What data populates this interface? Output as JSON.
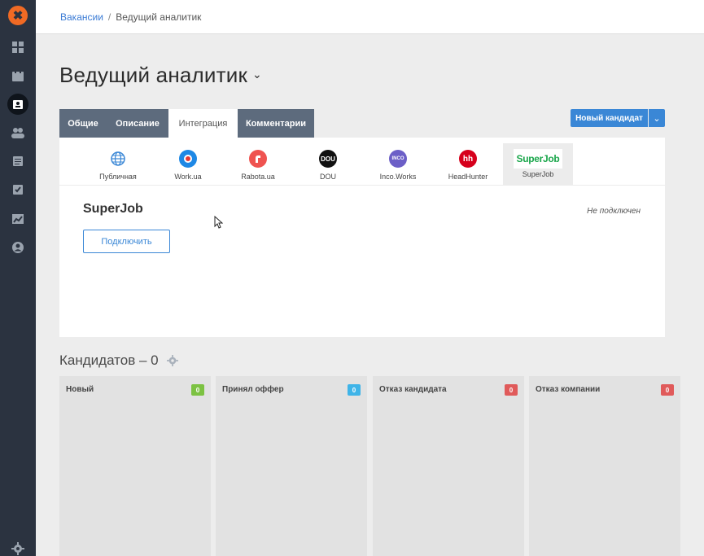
{
  "logo": "✖",
  "sidebar": {
    "items": [
      {
        "icon": "dashboard-icon",
        "active": false
      },
      {
        "icon": "calendar-icon",
        "active": false
      },
      {
        "icon": "vacancies-icon",
        "active": true
      },
      {
        "icon": "users-icon",
        "active": false
      },
      {
        "icon": "library-icon",
        "active": false
      },
      {
        "icon": "tasks-icon",
        "active": false
      },
      {
        "icon": "analytics-icon",
        "active": false
      },
      {
        "icon": "profile-icon",
        "active": false
      }
    ],
    "settings_icon": "gear-icon"
  },
  "breadcrumb": {
    "link": "Вакансии",
    "separator": "/",
    "current": "Ведущий аналитик"
  },
  "page_title": "Ведущий аналитик",
  "tabs": [
    {
      "label": "Общие"
    },
    {
      "label": "Описание"
    },
    {
      "label": "Интеграция"
    },
    {
      "label": "Комментарии"
    }
  ],
  "new_candidate_button": "Новый кандидат",
  "integrations": [
    {
      "label": "Публичная",
      "icon": "globe-icon",
      "color": "#3a87d6"
    },
    {
      "label": "Work.ua",
      "icon": "workua-icon",
      "color": "#1e88e5"
    },
    {
      "label": "Rabota.ua",
      "icon": "rabotaua-icon",
      "color": "#ef5350"
    },
    {
      "label": "DOU",
      "icon": "dou-icon",
      "color": "#111111",
      "glyph": "DOU"
    },
    {
      "label": "Inco.Works",
      "icon": "incoworks-icon",
      "color": "#6c5fc7",
      "glyph": "INCO"
    },
    {
      "label": "HeadHunter",
      "icon": "headhunter-icon",
      "color": "#d6001c",
      "glyph": "hh"
    },
    {
      "label": "SuperJob",
      "icon": "superjob-logo",
      "color": "#1aa64b",
      "glyph": "SuperJob"
    }
  ],
  "selected_integration": {
    "name": "SuperJob",
    "status": "Не подключен",
    "connect_button": "Подключить"
  },
  "candidates": {
    "title": "Кандидатов – 0",
    "columns": [
      {
        "name": "Новый",
        "count": "0",
        "color": "#7cc242"
      },
      {
        "name": "Принял оффер",
        "count": "0",
        "color": "#3fb4e8"
      },
      {
        "name": "Отказ кандидата",
        "count": "0",
        "color": "#e05a5a"
      },
      {
        "name": "Отказ компании",
        "count": "0",
        "color": "#e05a5a"
      }
    ]
  }
}
